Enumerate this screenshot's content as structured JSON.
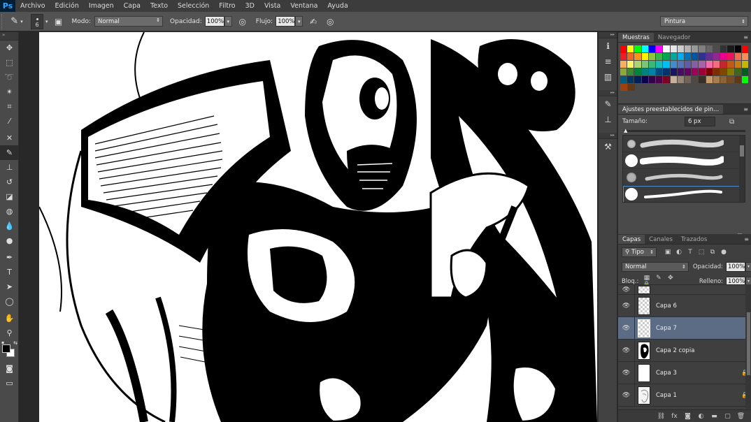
{
  "app": {
    "logo": "Ps"
  },
  "menu": [
    "Archivo",
    "Edición",
    "Imagen",
    "Capa",
    "Texto",
    "Selección",
    "Filtro",
    "3D",
    "Vista",
    "Ventana",
    "Ayuda"
  ],
  "options": {
    "brush_size": "6",
    "mode_label": "Modo:",
    "mode_value": "Normal",
    "opacity_label": "Opacidad:",
    "opacity_value": "100%",
    "flow_label": "Flujo:",
    "flow_value": "100%",
    "workspace": "Pintura"
  },
  "swatches_panel": {
    "tabs": [
      "Muestras",
      "Navegador"
    ],
    "colors": [
      [
        "#ff0000",
        "#ffff00",
        "#00ff00",
        "#00ffff",
        "#0000ff",
        "#ff00ff",
        "#ffffff",
        "#e6e6e6",
        "#cccccc",
        "#b3b3b3",
        "#999999",
        "#808080",
        "#666666",
        "#4d4d4d",
        "#333333",
        "#1a1a1a",
        "#000000",
        "#ff0000"
      ],
      [
        "#ee1d24",
        "#f26522",
        "#f7941d",
        "#fff200",
        "#8dc63f",
        "#39b54a",
        "#00a651",
        "#00a99d",
        "#00aeef",
        "#0072bc",
        "#0054a6",
        "#2e3192",
        "#662d91",
        "#92278f",
        "#ec008c",
        "#ed145b",
        "#f26c4f",
        "#f68e55"
      ],
      [
        "#fbaf5c",
        "#fff467",
        "#acd372",
        "#7cc576",
        "#3bb878",
        "#1abbb4",
        "#00bff3",
        "#438ccb",
        "#5574b9",
        "#605ca8",
        "#855fa8",
        "#a763a9",
        "#f06ea9",
        "#f26d7d",
        "#c1272d",
        "#c25a15",
        "#c97d0e",
        "#c6b600"
      ],
      [
        "#8ba83a",
        "#3a8a2f",
        "#00843d",
        "#00827f",
        "#0082a6",
        "#004a80",
        "#003471",
        "#1b1464",
        "#440e62",
        "#630460",
        "#9e005d",
        "#9e0039",
        "#790000",
        "#7b2e00",
        "#7d4900",
        "#827b00",
        "#406618",
        "#005e20"
      ],
      [
        "#005b7f",
        "#003663",
        "#002157",
        "#0d004c",
        "#32004b",
        "#4b0049",
        "#7a0026",
        "#c7b299",
        "#998675",
        "#736357",
        "#534741",
        "#37302a",
        "#c69c6d",
        "#a67c52",
        "#8c6239",
        "#754c24",
        "#603913",
        "#00ff00"
      ],
      [
        "#a0410d",
        "#603917"
      ]
    ]
  },
  "brush_panel": {
    "title": "Ajustes preestablecidos de pin...",
    "size_label": "Tamaño:",
    "size_value": "6 px"
  },
  "layers_panel": {
    "tabs": [
      "Capas",
      "Canales",
      "Trazados"
    ],
    "filter_kind": "Tipo",
    "blend_mode": "Normal",
    "opacity_label": "Opacidad:",
    "opacity_value": "100%",
    "lock_label": "Bloq.:",
    "fill_label": "Relleno:",
    "fill_value": "100%",
    "layers": [
      {
        "name": "Capa 6",
        "selected": false,
        "locked": false,
        "thumb": "transparent"
      },
      {
        "name": "Capa 7",
        "selected": true,
        "locked": false,
        "thumb": "transparent"
      },
      {
        "name": "Capa 2 copia",
        "selected": false,
        "locked": false,
        "thumb": "art"
      },
      {
        "name": "Capa 3",
        "selected": false,
        "locked": true,
        "thumb": "white"
      },
      {
        "name": "Capa 1",
        "selected": false,
        "locked": true,
        "thumb": "sketch"
      }
    ]
  }
}
